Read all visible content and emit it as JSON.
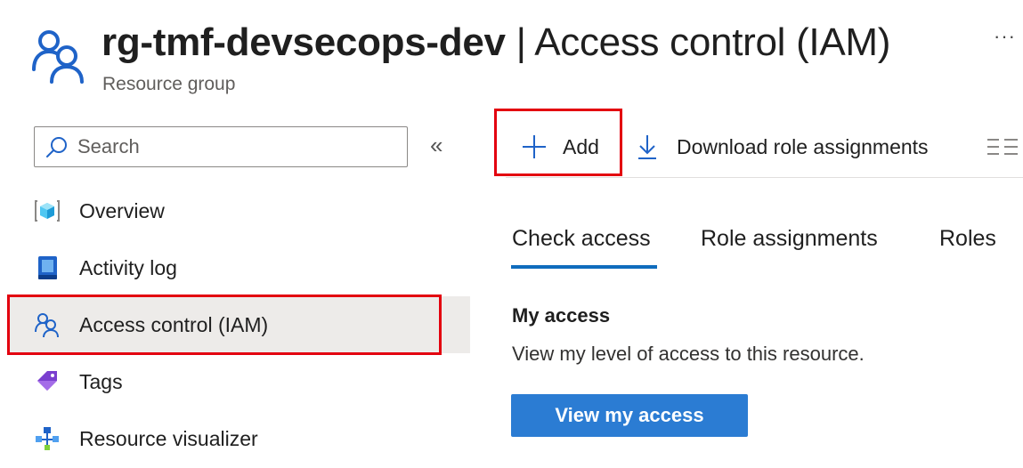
{
  "header": {
    "resource_name": "rg-tmf-devsecops-dev",
    "separator": " | ",
    "page_name": "Access control (IAM)",
    "subtitle": "Resource group",
    "more_label": "···"
  },
  "sidebar": {
    "search_placeholder": "Search",
    "collapse_label": "«",
    "items": [
      {
        "label": "Overview",
        "icon": "overview-icon"
      },
      {
        "label": "Activity log",
        "icon": "activity-log-icon"
      },
      {
        "label": "Access control (IAM)",
        "icon": "people-icon",
        "active": true
      },
      {
        "label": "Tags",
        "icon": "tag-icon"
      },
      {
        "label": "Resource visualizer",
        "icon": "visualizer-icon"
      }
    ]
  },
  "toolbar": {
    "add_label": "Add",
    "download_label": "Download role assignments"
  },
  "tabs": [
    {
      "label": "Check access",
      "selected": true
    },
    {
      "label": "Role assignments"
    },
    {
      "label": "Roles"
    }
  ],
  "main": {
    "section_title": "My access",
    "section_desc": "View my level of access to this resource.",
    "button_label": "View my access"
  },
  "colors": {
    "accent": "#0f6cbd",
    "primary_button": "#2b7cd3",
    "highlight_border": "#e3000f",
    "active_nav": "#edebe9"
  }
}
